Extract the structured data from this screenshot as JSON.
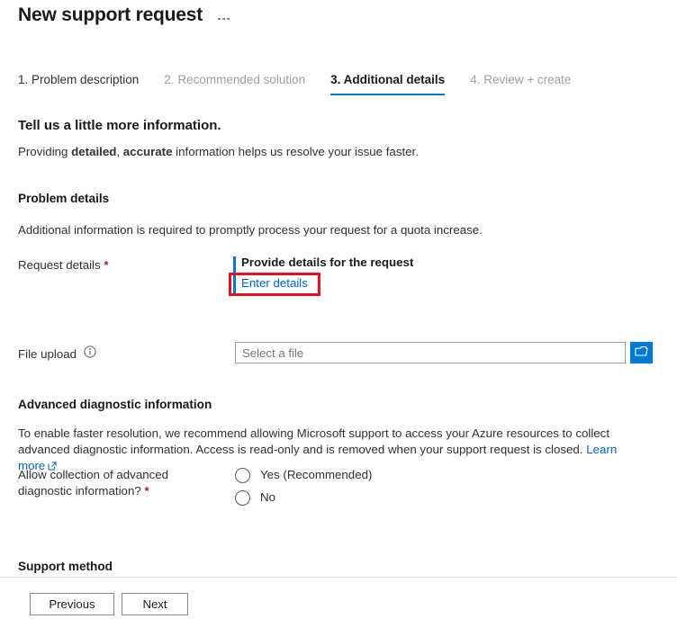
{
  "header": {
    "title": "New support request",
    "more_menu": "…"
  },
  "tabs": [
    {
      "label": "1. Problem description",
      "state": "done"
    },
    {
      "label": "2. Recommended solution",
      "state": "disabled"
    },
    {
      "label": "3. Additional details",
      "state": "active"
    },
    {
      "label": "4. Review + create",
      "state": "disabled"
    }
  ],
  "intro": {
    "heading": "Tell us a little more information.",
    "desc_part1": "Providing ",
    "desc_bold1": "detailed",
    "desc_part2": ", ",
    "desc_bold2": "accurate",
    "desc_part3": " information helps us resolve your issue faster."
  },
  "problem_details": {
    "section_title": "Problem details",
    "description": "Additional information is required to promptly process your request for a quota increase.",
    "request_details": {
      "label": "Request details",
      "required_mark": "*",
      "value_title": "Provide details for the request",
      "link_label": "Enter details",
      "accent_color": "#0078d4",
      "highlight_color": "#e81123"
    },
    "file_upload": {
      "label": "File upload",
      "info_icon": "info-icon",
      "placeholder": "Select a file",
      "value": "",
      "browse_icon": "folder-icon",
      "browse_color": "#0078d4"
    }
  },
  "advanced_diagnostics": {
    "section_title": "Advanced diagnostic information",
    "description": "To enable faster resolution, we recommend allowing Microsoft support to access your Azure resources to collect advanced diagnostic information. Access is read-only and is removed when your support request is closed.",
    "learn_more": "Learn more",
    "question_label": "Allow collection of advanced diagnostic information?",
    "required_mark": "*",
    "options": [
      {
        "label": "Yes (Recommended)",
        "selected": false
      },
      {
        "label": "No",
        "selected": false
      }
    ]
  },
  "support_method": {
    "section_title": "Support method"
  },
  "footer": {
    "previous": "Previous",
    "next": "Next"
  }
}
